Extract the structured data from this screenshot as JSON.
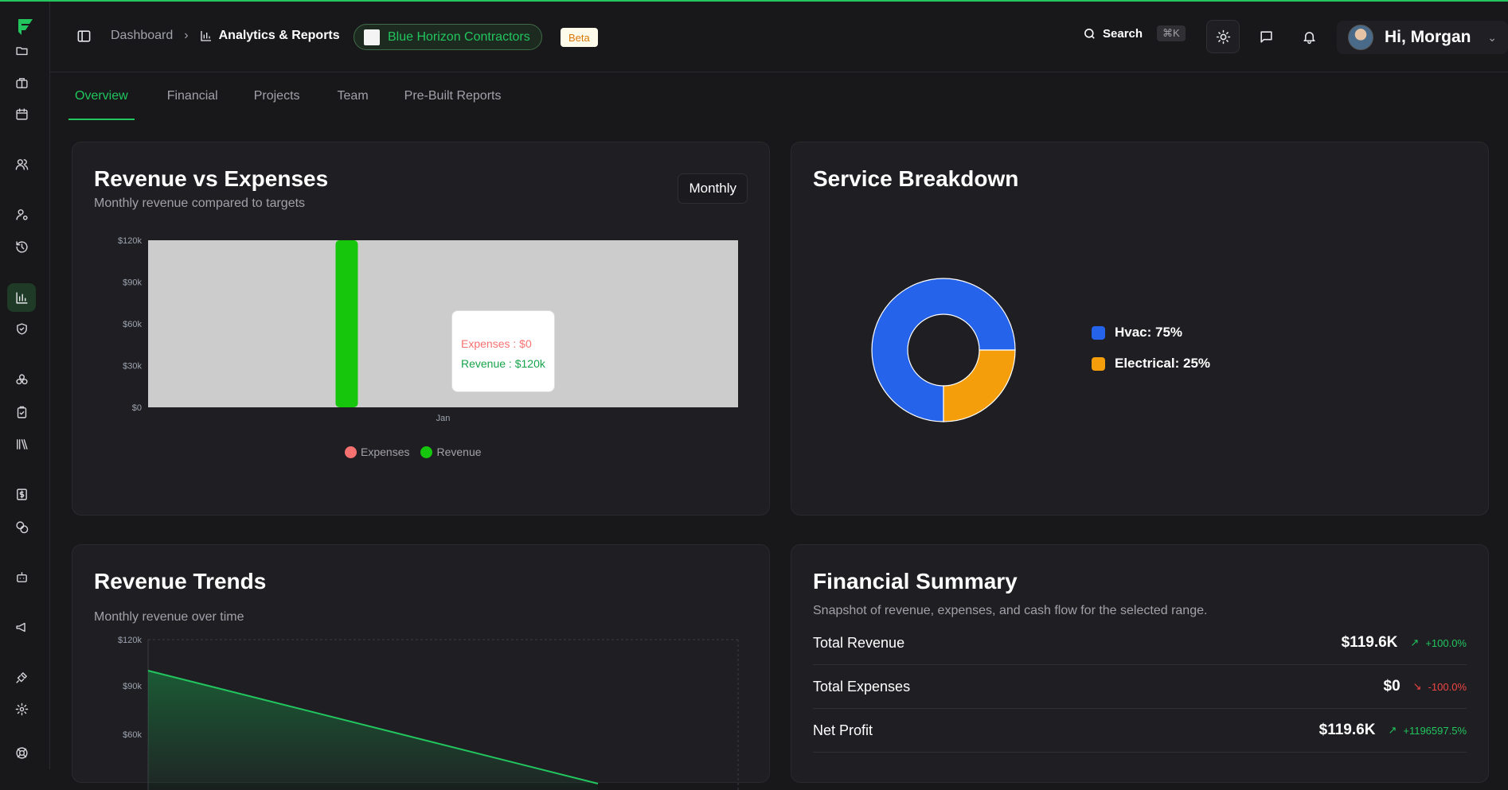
{
  "colors": {
    "accent": "#22c55e",
    "revenue": "#16c60c",
    "expenses": "#f87171",
    "hvac": "#2563eb",
    "electrical": "#f59e0b"
  },
  "sidebar": {
    "icons": [
      "folder-icon",
      "briefcase-icon",
      "calendar-icon",
      "users-icon",
      "user-gear-icon",
      "history-icon",
      "chart-icon",
      "shield-check-icon",
      "nodes-icon",
      "clipboard-check-icon",
      "library-icon",
      "invoice-icon",
      "coins-icon",
      "bot-icon",
      "megaphone-icon",
      "plug-icon",
      "settings-icon",
      "help-icon"
    ],
    "active": "chart-icon"
  },
  "header": {
    "breadcrumb_root": "Dashboard",
    "breadcrumb_current": "Analytics & Reports",
    "client": "Blue Horizon Contractors",
    "beta": "Beta",
    "search_label": "Search",
    "search_shortcut": "⌘K",
    "greeting": "Hi, Morgan"
  },
  "tabs": [
    {
      "label": "Overview",
      "active": true
    },
    {
      "label": "Financial",
      "active": false
    },
    {
      "label": "Projects",
      "active": false
    },
    {
      "label": "Team",
      "active": false
    },
    {
      "label": "Pre-Built Reports",
      "active": false
    }
  ],
  "revenue_vs_expenses": {
    "title": "Revenue vs Expenses",
    "subtitle": "Monthly revenue compared to targets",
    "period": "Monthly",
    "tooltip": {
      "expenses": "Expenses : $0",
      "revenue": "Revenue : $120k"
    },
    "legend": {
      "expenses": "Expenses",
      "revenue": "Revenue"
    }
  },
  "service_breakdown": {
    "title": "Service Breakdown",
    "items": [
      {
        "label": "Hvac: 75%",
        "value": 75,
        "color": "#2563eb"
      },
      {
        "label": "Electrical: 25%",
        "value": 25,
        "color": "#f59e0b"
      }
    ]
  },
  "revenue_trends": {
    "title": "Revenue Trends",
    "subtitle": "Monthly revenue over time"
  },
  "financial_summary": {
    "title": "Financial Summary",
    "subtitle": "Snapshot of revenue, expenses, and cash flow for the selected range.",
    "rows": [
      {
        "label": "Total Revenue",
        "value": "$119.6K",
        "change": "+100.0%",
        "direction": "up"
      },
      {
        "label": "Total Expenses",
        "value": "$0",
        "change": "-100.0%",
        "direction": "down"
      },
      {
        "label": "Net Profit",
        "value": "$119.6K",
        "change": "+1196597.5%",
        "direction": "up"
      }
    ]
  },
  "chart_data": [
    {
      "type": "bar",
      "title": "Revenue vs Expenses",
      "categories": [
        "Jan"
      ],
      "series": [
        {
          "name": "Expenses",
          "values": [
            0
          ]
        },
        {
          "name": "Revenue",
          "values": [
            120000
          ]
        }
      ],
      "yticks": [
        "$0",
        "$30k",
        "$60k",
        "$90k",
        "$120k"
      ],
      "ylim": [
        0,
        120000
      ],
      "legend": "bottom"
    },
    {
      "type": "pie",
      "title": "Service Breakdown",
      "categories": [
        "Hvac",
        "Electrical"
      ],
      "values": [
        75,
        25
      ],
      "legend": "right"
    },
    {
      "type": "area",
      "title": "Revenue Trends",
      "yticks": [
        "$60k",
        "$90k",
        "$120k"
      ],
      "ylim": [
        0,
        120000
      ],
      "grid": true
    }
  ]
}
